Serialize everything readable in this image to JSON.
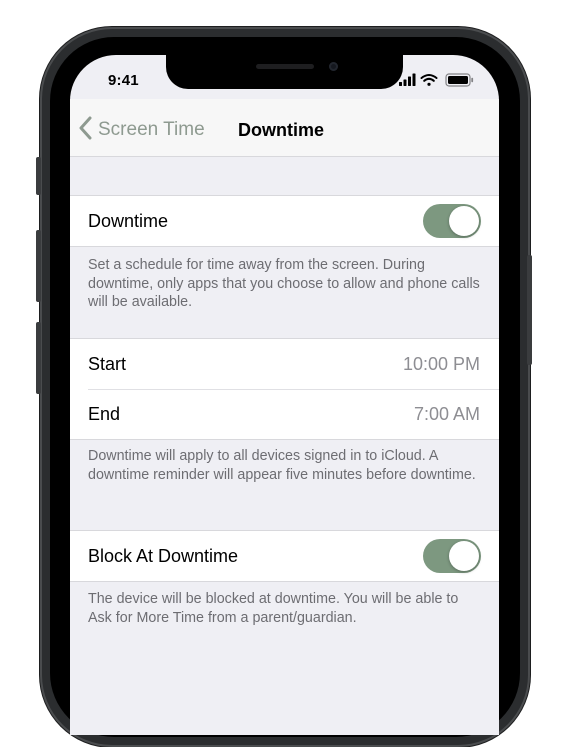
{
  "status_bar": {
    "time": "9:41",
    "icons": [
      "cellular-signal-icon",
      "wifi-icon",
      "battery-icon"
    ]
  },
  "nav": {
    "back_label": "Screen Time",
    "title": "Downtime"
  },
  "downtime_group": {
    "label": "Downtime",
    "toggle_on": true,
    "footnote": "Set a schedule for time away from the screen. During downtime, only apps that you choose to allow and phone calls will be available."
  },
  "schedule_group": {
    "start_label": "Start",
    "start_value": "10:00 PM",
    "end_label": "End",
    "end_value": "7:00 AM",
    "footnote": "Downtime will apply to all devices signed in to iCloud. A downtime reminder will appear five minutes before downtime."
  },
  "block_group": {
    "label": "Block At Downtime",
    "toggle_on": true,
    "footnote": "The device will be blocked at downtime. You will be able to Ask for More Time from a parent/guardian."
  },
  "colors": {
    "toggle_on": "#7d9880",
    "secondary_text": "#8e8e93",
    "background": "#efeff4"
  }
}
